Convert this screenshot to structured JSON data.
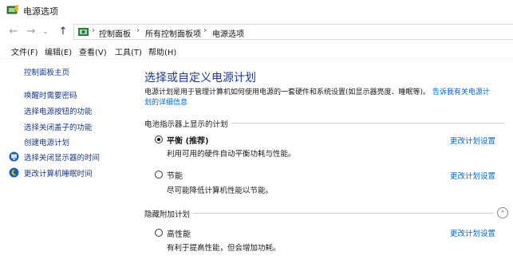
{
  "window": {
    "title": "电源选项"
  },
  "address": {
    "crumbs": [
      "控制面板",
      "所有控制面板项",
      "电源选项"
    ]
  },
  "menu": {
    "items": [
      "文件(F)",
      "编辑(E)",
      "查看(V)",
      "工具(T)",
      "帮助(H)"
    ]
  },
  "sidebar": {
    "home": "控制面板主页",
    "links": [
      "唤醒时需要密码",
      "选择电源按钮的功能",
      "选择关闭盖子的功能",
      "创建电源计划",
      "选择关闭显示器的时间",
      "更改计算机睡眠时间"
    ]
  },
  "main": {
    "heading": "选择或自定义电源计划",
    "description": "电源计划是用于管理计算机如何使用电源的一套硬件和系统设置(如显示器亮度、睡眠等)。",
    "help_link": "告诉我有关电源计划的详细信息",
    "battery_section_title": "电池指示器上显示的计划",
    "hidden_section_title": "隐藏附加计划",
    "change_link": "更改计划设置",
    "plans": [
      {
        "name": "平衡 (推荐)",
        "desc": "利用可用的硬件自动平衡功耗与性能。",
        "selected": true
      },
      {
        "name": "节能",
        "desc": "尽可能降低计算机性能以节能。",
        "selected": false
      },
      {
        "name": "高性能",
        "desc": "有利于提高性能，但会增加功耗。",
        "selected": false
      }
    ]
  }
}
